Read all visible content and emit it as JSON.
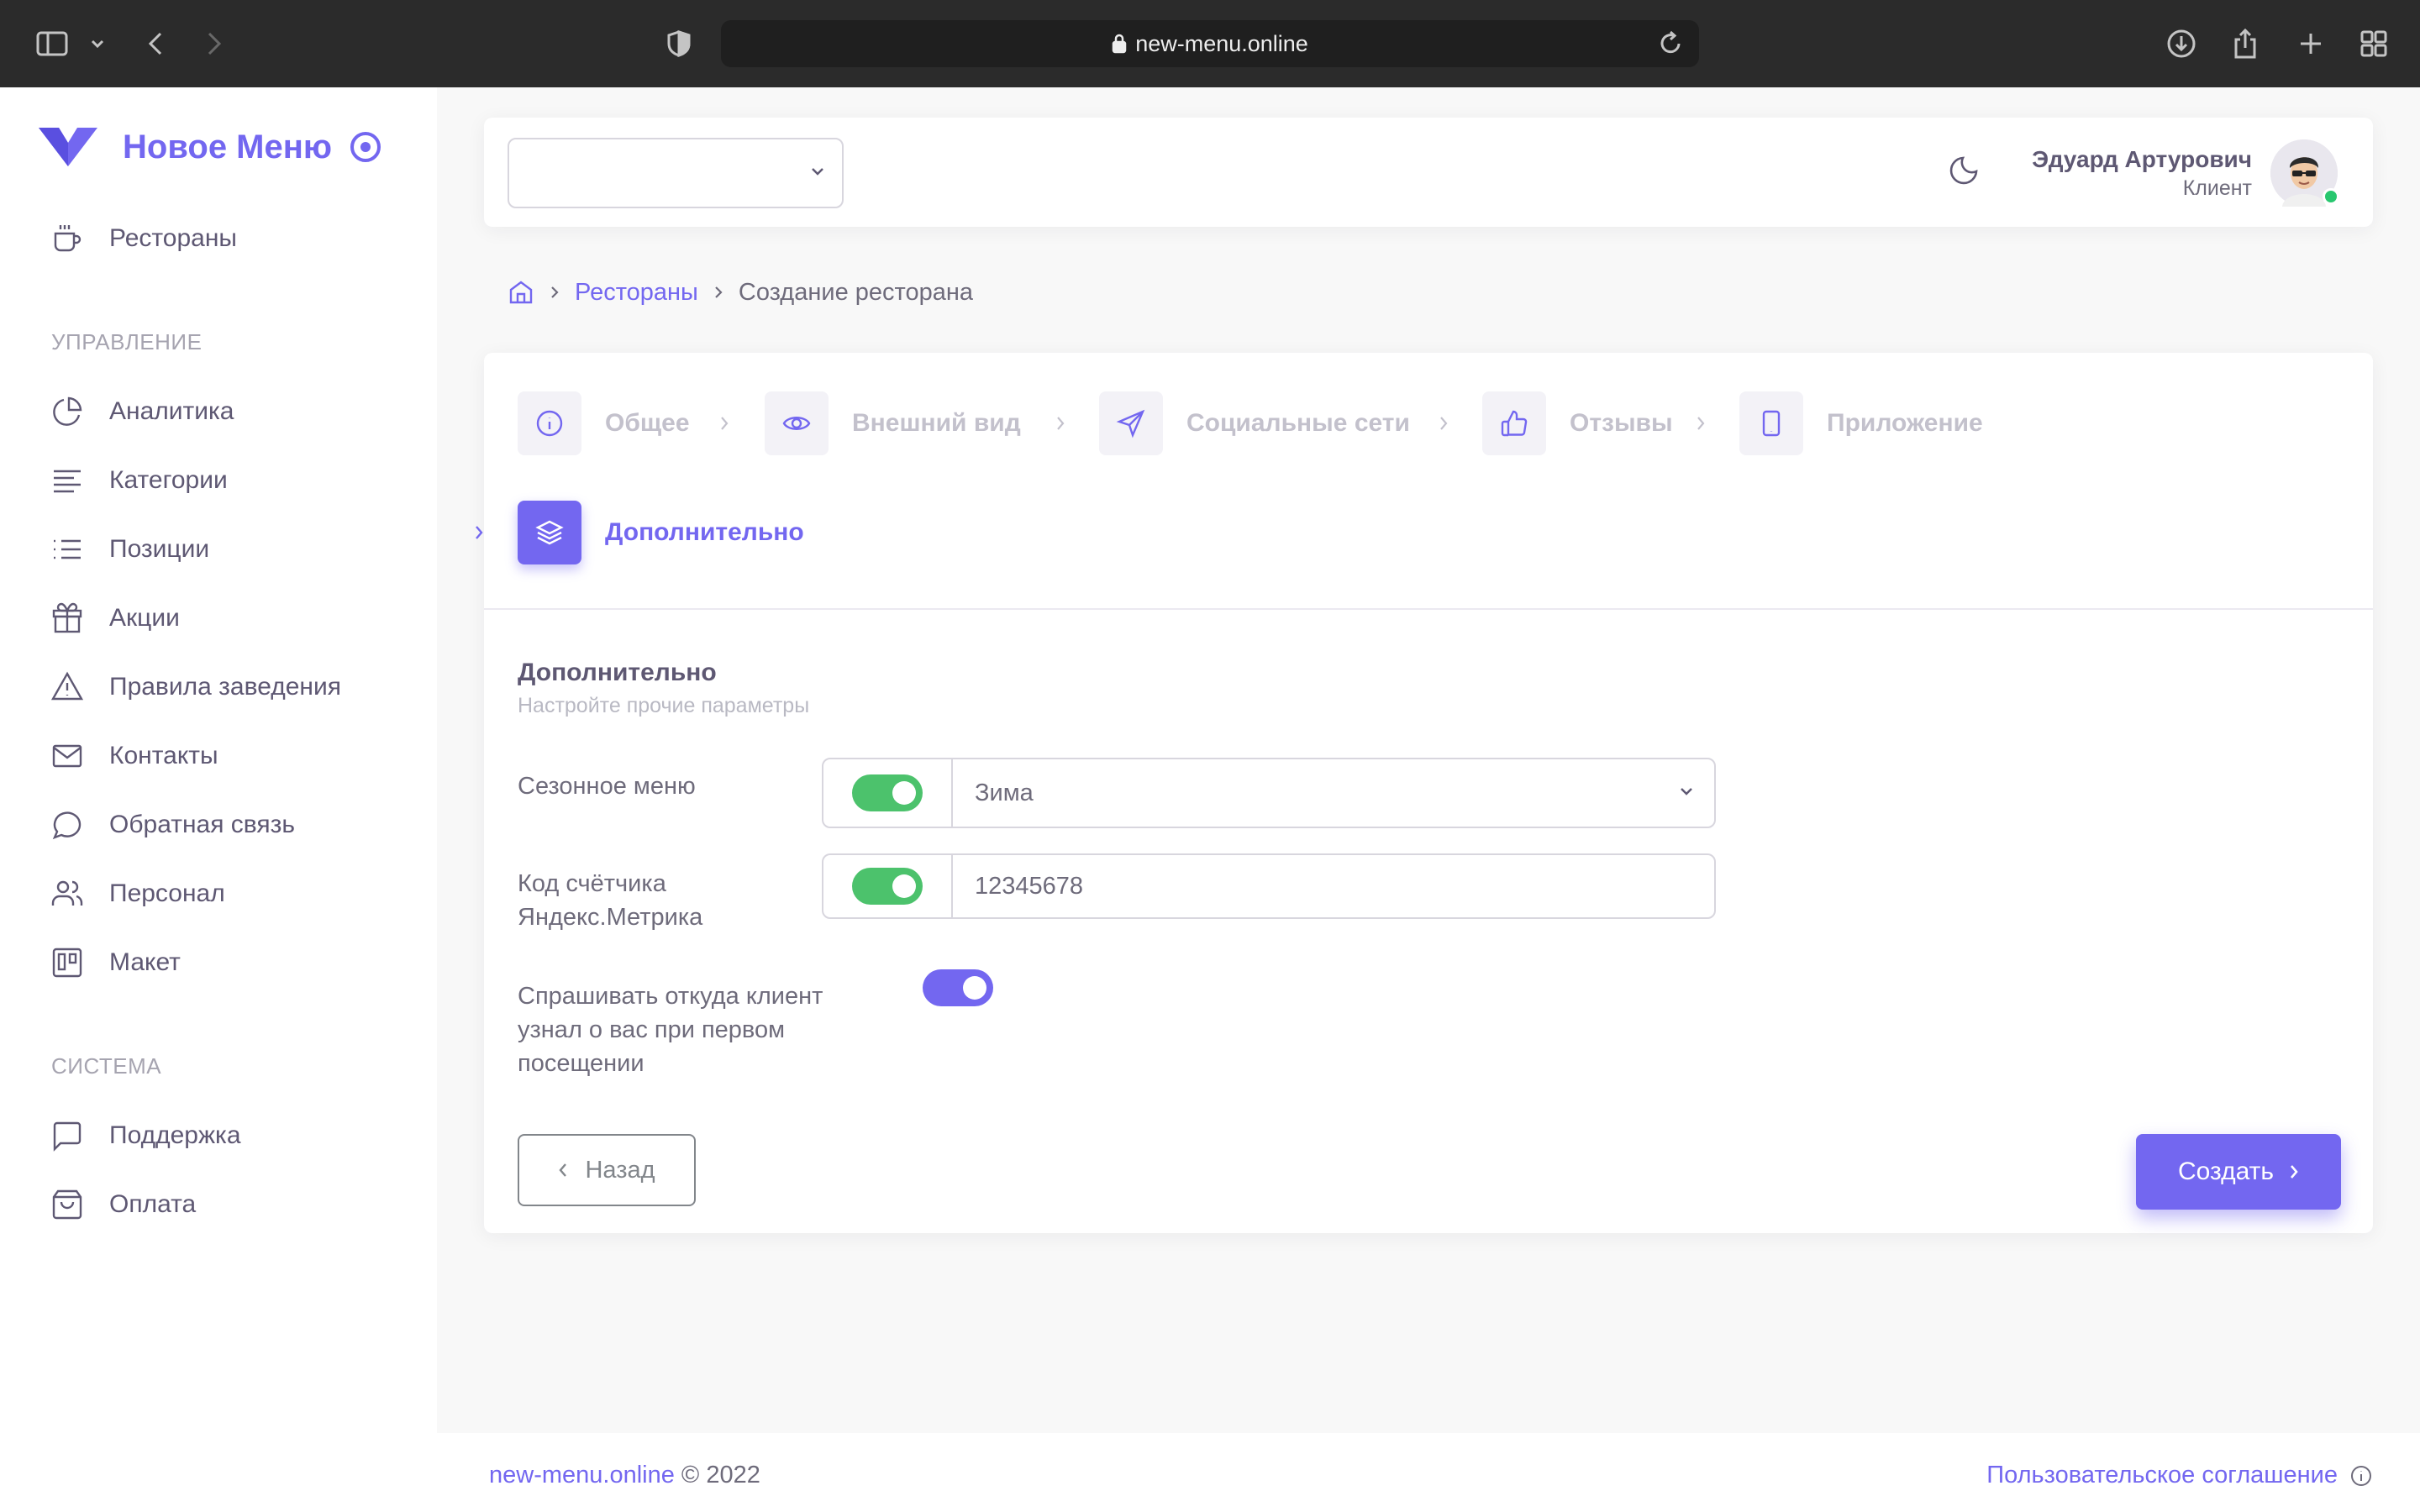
{
  "browser": {
    "url": "new-menu.online"
  },
  "sidebar": {
    "brand": "Новое Меню",
    "top_item": "Рестораны",
    "section_manage": "УПРАВЛЕНИЕ",
    "manage_items": [
      "Аналитика",
      "Категории",
      "Позиции",
      "Акции",
      "Правила заведения",
      "Контакты",
      "Обратная связь",
      "Персонал",
      "Макет"
    ],
    "section_system": "СИСТЕМА",
    "system_items": [
      "Поддержка",
      "Оплата"
    ]
  },
  "topbar": {
    "select_value": "",
    "user_name": "Эдуард Артурович",
    "user_role": "Клиент"
  },
  "breadcrumb": {
    "parent": "Рестораны",
    "current": "Создание ресторана"
  },
  "steps": [
    "Общее",
    "Внешний вид",
    "Социальные сети",
    "Отзывы",
    "Приложение",
    "Дополнительно"
  ],
  "active_step": "Дополнительно",
  "form": {
    "title": "Дополнительно",
    "subtitle": "Настройте прочие параметры",
    "seasonal_label": "Сезонное меню",
    "seasonal_enabled": true,
    "seasonal_value": "Зима",
    "metrika_label_1": "Код счётчика",
    "metrika_label_2": "Яндекс.Метрика",
    "metrika_enabled": true,
    "metrika_value": "12345678",
    "ask_label_1": "Спрашивать откуда клиент",
    "ask_label_2": "узнал о вас при первом",
    "ask_label_3": "посещении",
    "ask_enabled": true,
    "back_label": "Назад",
    "create_label": "Создать"
  },
  "footer": {
    "site_link": "new-menu.online",
    "copyright": "© 2022",
    "agreement": "Пользовательское соглашение"
  },
  "colors": {
    "accent": "#7367f0",
    "toggle_on": "#4cc26c",
    "text": "#5e5873"
  }
}
